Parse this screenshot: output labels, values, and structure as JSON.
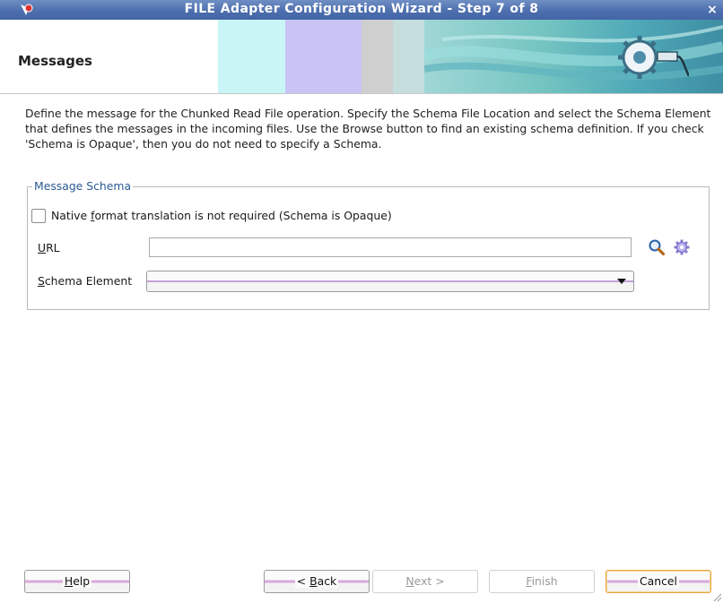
{
  "window": {
    "title": "FILE Adapter Configuration Wizard - Step 7 of 8",
    "close_glyph": "×"
  },
  "banner": {
    "heading": "Messages"
  },
  "intro": {
    "text": "Define the message for the Chunked Read File operation.  Specify the Schema File Location and select the Schema Element that defines the messages in the incoming files. Use the Browse button to find an existing schema definition. If you check 'Schema is Opaque', then you do not need to specify a Schema."
  },
  "message_schema": {
    "group_title": "Message Schema",
    "opaque_checkbox": {
      "label_pre": "Native ",
      "label_mnemonic": "f",
      "label_post": "ormat translation is not required (Schema is Opaque)",
      "checked": false
    },
    "url": {
      "label_mnemonic": "U",
      "label_rest": "RL",
      "value": "",
      "search_icon": "search-icon",
      "gear_icon": "gear-icon"
    },
    "schema_element": {
      "label_mnemonic": "S",
      "label_rest": "chema Element",
      "value": ""
    }
  },
  "footer": {
    "help": {
      "mnemonic": "H",
      "rest": "elp"
    },
    "back": {
      "pre": "< ",
      "mnemonic": "B",
      "rest": "ack"
    },
    "next": {
      "mnemonic": "N",
      "rest": "ext >"
    },
    "finish": {
      "mnemonic": "F",
      "rest": "inish"
    },
    "cancel": {
      "label": "Cancel"
    }
  },
  "colors": {
    "titlebar": "#4e6fae",
    "group_title": "#2a5b94",
    "default_button_border": "#e8a640"
  }
}
